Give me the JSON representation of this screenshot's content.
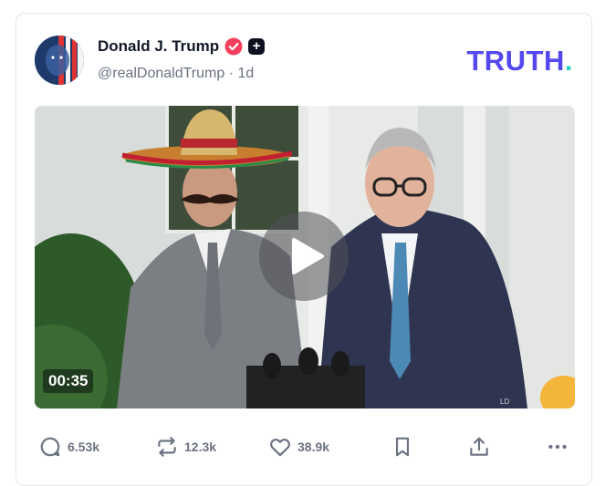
{
  "post": {
    "author_name": "Donald J. Trump",
    "handle": "@realDonaldTrump",
    "separator": "·",
    "time_ago": "1d",
    "plus_badge": "+",
    "brand": {
      "text": "TRUTH",
      "dot": ".",
      "color": "#5448ee",
      "dot_color": "#2dd4bf"
    },
    "verified_color": "#f43f5e"
  },
  "media": {
    "type": "video",
    "duration": "00:35",
    "watermark": "LD"
  },
  "actions": {
    "replies": "6.53k",
    "retruths": "12.3k",
    "likes": "38.9k"
  }
}
